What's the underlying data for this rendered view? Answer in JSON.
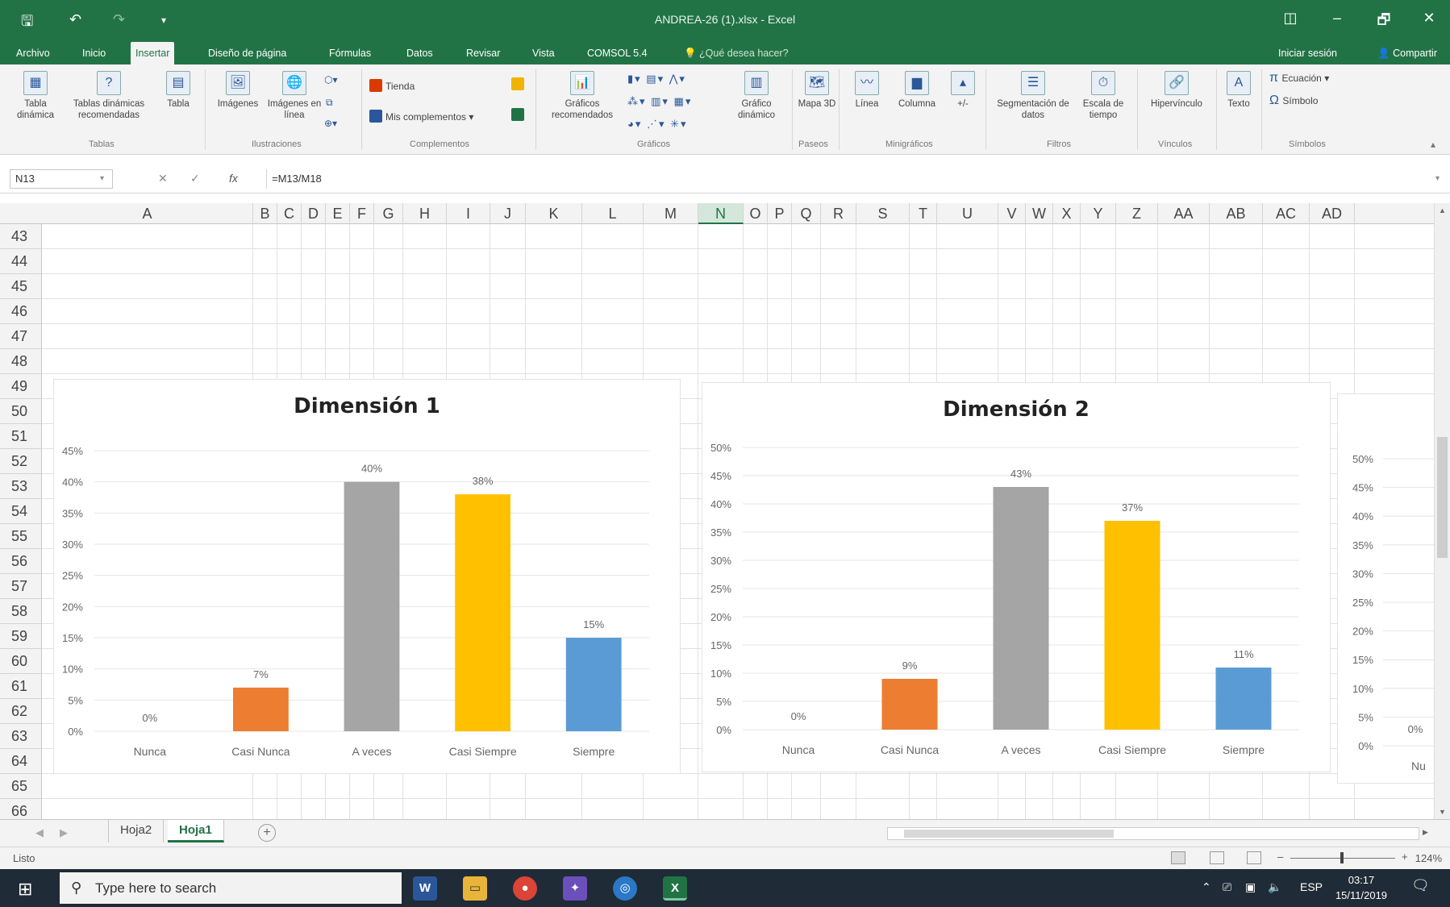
{
  "window": {
    "title": "ANDREA-26 (1).xlsx - Excel",
    "controls": {
      "ribbon_display": "◫",
      "minimize": "–",
      "restore": "🗗",
      "close": "✕"
    }
  },
  "quick_access": {
    "save_icon": "save-icon",
    "undo": "↶",
    "redo": "↷"
  },
  "tabs": [
    {
      "label": "Archivo"
    },
    {
      "label": "Inicio"
    },
    {
      "label": "Insertar"
    },
    {
      "label": "Diseño de página"
    },
    {
      "label": "Fórmulas"
    },
    {
      "label": "Datos"
    },
    {
      "label": "Revisar"
    },
    {
      "label": "Vista"
    },
    {
      "label": "COMSOL 5.4"
    }
  ],
  "active_tab": "Insertar",
  "tell_me": "¿Qué desea hacer?",
  "sign_in": "Iniciar sesión",
  "share": "Compartir",
  "ribbon": {
    "tabla_dinamica": "Tabla dinámica",
    "tablas_recomendadas": "Tablas dinámicas recomendadas",
    "tabla": "Tabla",
    "imagenes": "Imágenes",
    "imagenes_linea": "Imágenes en línea",
    "tienda": "Tienda",
    "mis_complementos": "Mis complementos",
    "graficos_recomendados": "Gráficos recomendados",
    "grafico_dinamico": "Gráfico dinámico",
    "mapa_3d": "Mapa 3D",
    "linea": "Línea",
    "columna": "Columna",
    "ganancia_perdida": "+/-",
    "segmentacion": "Segmentación de datos",
    "escala_tiempo": "Escala de tiempo",
    "hipervinculo": "Hipervínculo",
    "texto": "Texto",
    "ecuacion": "Ecuación",
    "simbolo": "Símbolo",
    "groups": {
      "tablas": "Tablas",
      "ilustraciones": "Ilustraciones",
      "complementos": "Complementos",
      "graficos": "Gráficos",
      "paseos": "Paseos",
      "minigraficos": "Minigráficos",
      "filtros": "Filtros",
      "vinculos": "Vínculos",
      "simbolos": "Símbolos"
    }
  },
  "formula_bar": {
    "name_box": "N13",
    "fx": "fx",
    "formula": "=M13/M18"
  },
  "columns": [
    "A",
    "B",
    "C",
    "D",
    "E",
    "F",
    "G",
    "H",
    "I",
    "J",
    "K",
    "L",
    "M",
    "N",
    "O",
    "P",
    "Q",
    "R",
    "S",
    "T",
    "U",
    "V",
    "W",
    "X",
    "Y",
    "Z",
    "AA",
    "AB",
    "AC",
    "AD"
  ],
  "selected_column": "N",
  "rows": [
    "43",
    "44",
    "45",
    "46",
    "47",
    "48",
    "49",
    "50",
    "51",
    "52",
    "53",
    "54",
    "55",
    "56",
    "57",
    "58",
    "59",
    "60",
    "61",
    "62",
    "63",
    "64",
    "65",
    "66"
  ],
  "charts": [
    {
      "title": "Dimensión 1"
    },
    {
      "title": "Dimensión 2"
    }
  ],
  "partial_chart": {
    "ticks": [
      "0%",
      "5%",
      "10%",
      "15%",
      "20%",
      "25%",
      "30%",
      "35%",
      "40%",
      "45%",
      "50%"
    ],
    "first_label": "0%",
    "first_category": "Nu"
  },
  "chart_data": [
    {
      "type": "bar",
      "title": "Dimensión 1",
      "categories": [
        "Nunca",
        "Casi Nunca",
        "A veces",
        "Casi Siempre",
        "Siempre"
      ],
      "values": [
        0,
        7,
        40,
        38,
        15
      ],
      "labels": [
        "0%",
        "7%",
        "40%",
        "38%",
        "15%"
      ],
      "colors": [
        "#4472c4",
        "#ed7d31",
        "#a5a5a5",
        "#ffc000",
        "#5b9bd5"
      ],
      "ylim": [
        0,
        45
      ],
      "yticks": [
        "0%",
        "5%",
        "10%",
        "15%",
        "20%",
        "25%",
        "30%",
        "35%",
        "40%",
        "45%"
      ],
      "grid": true
    },
    {
      "type": "bar",
      "title": "Dimensión 2",
      "categories": [
        "Nunca",
        "Casi Nunca",
        "A veces",
        "Casi Siempre",
        "Siempre"
      ],
      "values": [
        0,
        9,
        43,
        37,
        11
      ],
      "labels": [
        "0%",
        "9%",
        "43%",
        "37%",
        "11%"
      ],
      "colors": [
        "#4472c4",
        "#ed7d31",
        "#a5a5a5",
        "#ffc000",
        "#5b9bd5"
      ],
      "ylim": [
        0,
        50
      ],
      "yticks": [
        "0%",
        "5%",
        "10%",
        "15%",
        "20%",
        "25%",
        "30%",
        "35%",
        "40%",
        "45%",
        "50%"
      ],
      "grid": true
    }
  ],
  "sheets": [
    {
      "label": "Hoja2"
    },
    {
      "label": "Hoja1"
    }
  ],
  "active_sheet": "Hoja1",
  "status": {
    "ready": "Listo",
    "zoom": "124%"
  },
  "taskbar": {
    "search_placeholder": "Type here to search",
    "language": "ESP",
    "time": "03:17",
    "date": "15/11/2019"
  }
}
